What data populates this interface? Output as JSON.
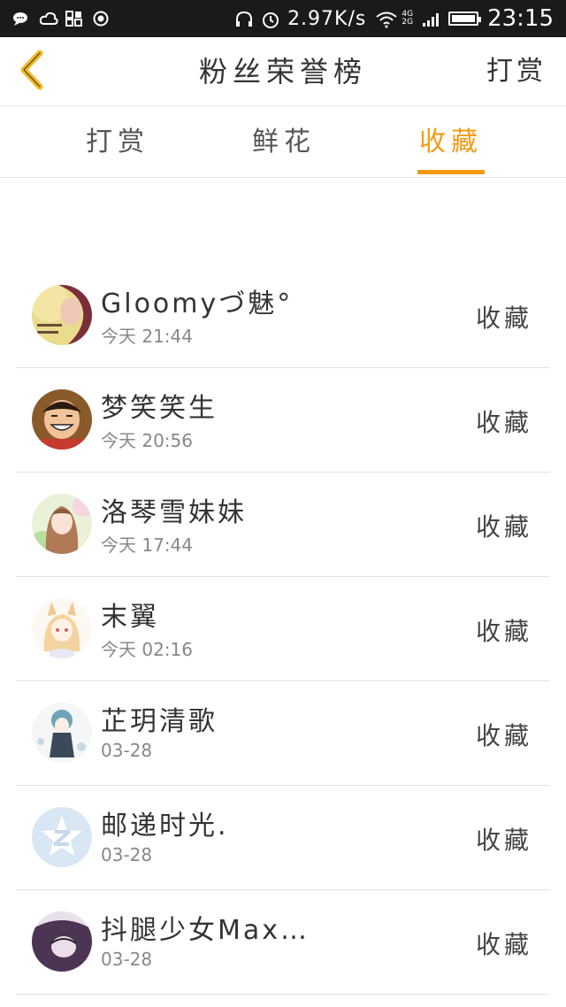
{
  "status_bar": {
    "net_speed": "2.97K/s",
    "net_type": [
      "4G",
      "2G"
    ],
    "time": "23:15"
  },
  "header": {
    "title": "粉丝荣誉榜",
    "action": "打赏"
  },
  "tabs": [
    {
      "label": "打赏",
      "active": false
    },
    {
      "label": "鲜花",
      "active": false
    },
    {
      "label": "收藏",
      "active": true
    }
  ],
  "accent_color": "#f39b14",
  "list": [
    {
      "name": "Gloomyづ魅°",
      "time": "今天 21:44",
      "action": "收藏"
    },
    {
      "name": "梦笑笑生",
      "time": "今天 20:56",
      "action": "收藏"
    },
    {
      "name": "洛琴雪妹妹",
      "time": "今天 17:44",
      "action": "收藏"
    },
    {
      "name": "末翼",
      "time": "今天 02:16",
      "action": "收藏"
    },
    {
      "name": "芷玥清歌",
      "time": "03-28",
      "action": "收藏"
    },
    {
      "name": "邮递时光.",
      "time": "03-28",
      "action": "收藏"
    },
    {
      "name": "抖腿少女Max…",
      "time": "03-28",
      "action": "收藏"
    }
  ]
}
